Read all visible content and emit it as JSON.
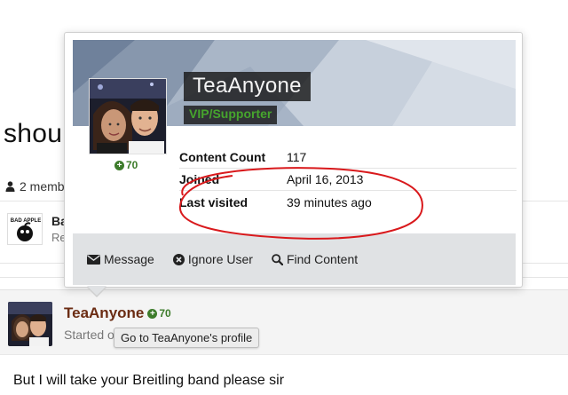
{
  "background": {
    "title_fragment": "shou",
    "members_text": "2 memb",
    "row_name_fragment": "Ba",
    "row_sub_fragment": "Re",
    "avatar_logo_text": "BAD APPLE"
  },
  "hovercard": {
    "username": "TeaAnyone",
    "group": "VIP/Supporter",
    "reputation": "70",
    "stats": [
      {
        "label": "Content Count",
        "value": "117"
      },
      {
        "label": "Joined",
        "value": "April 16, 2013"
      },
      {
        "label": "Last visited",
        "value": "39 minutes ago"
      }
    ],
    "actions": [
      {
        "label": "Message",
        "icon": "envelope-icon"
      },
      {
        "label": "Ignore User",
        "icon": "ignore-icon"
      },
      {
        "label": "Find Content",
        "icon": "search-icon"
      }
    ]
  },
  "post": {
    "author": "TeaAnyone",
    "reputation": "70",
    "started_text": "Started o",
    "tooltip": "Go to TeaAnyone's profile",
    "body": "But I will take your Breitling band please sir"
  },
  "colors": {
    "author_link": "#6b2c13",
    "rep_green": "#3d7c2b",
    "group_green": "#46a52d",
    "annotation_red": "#d9191c"
  }
}
